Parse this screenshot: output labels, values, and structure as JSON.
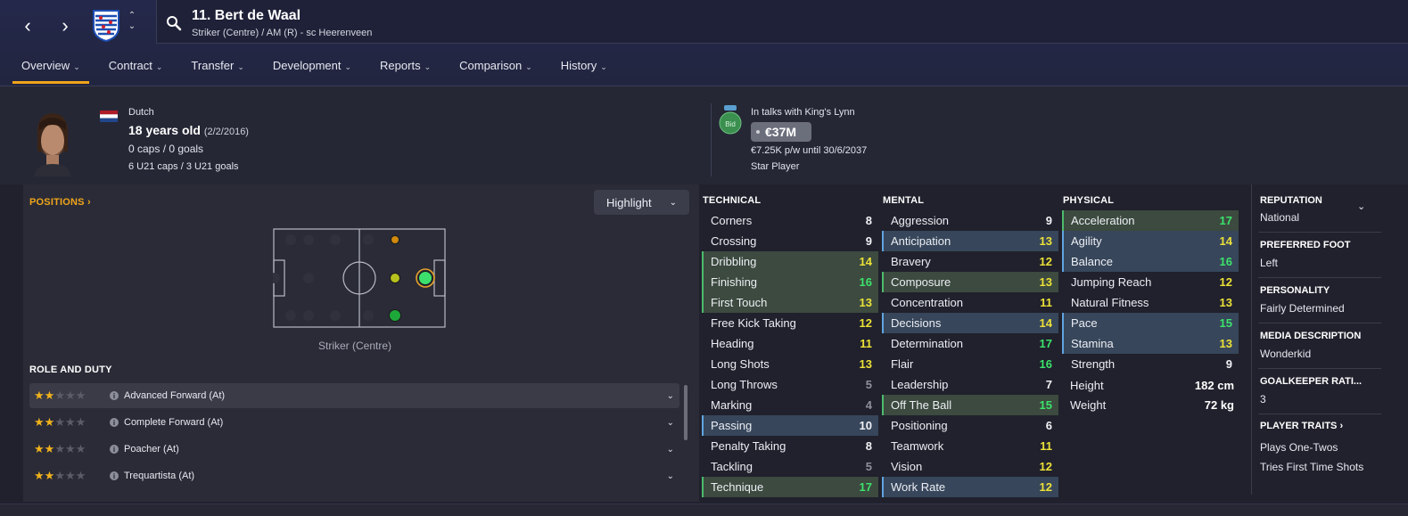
{
  "header": {
    "player_name": "11. Bert de Waal",
    "player_sub": "Striker (Centre) / AM (R) - sc Heerenveen",
    "tabs": [
      {
        "label": "Overview"
      },
      {
        "label": "Contract"
      },
      {
        "label": "Transfer"
      },
      {
        "label": "Development"
      },
      {
        "label": "Reports"
      },
      {
        "label": "Comparison"
      },
      {
        "label": "History"
      }
    ]
  },
  "info": {
    "nationality": "Dutch",
    "age": "18 years old",
    "dob": "(2/2/2016)",
    "caps": "0 caps / 0 goals",
    "u21_caps": "6 U21 caps / 3 U21 goals",
    "bid_label": "Bid",
    "talks": "In talks with King's Lynn",
    "value": "€37M",
    "wage": "€7.25K p/w until 30/6/2037",
    "status": "Star Player"
  },
  "positions": {
    "title": "POSITIONS",
    "highlight": "Highlight",
    "caption": "Striker (Centre)",
    "role_title": "ROLE AND DUTY",
    "roles": [
      {
        "name": "Advanced Forward (At)",
        "stars": 2
      },
      {
        "name": "Complete Forward (At)",
        "stars": 2
      },
      {
        "name": "Poacher (At)",
        "stars": 2
      },
      {
        "name": "Trequartista (At)",
        "stars": 2
      }
    ]
  },
  "attributes": {
    "technical_title": "TECHNICAL",
    "mental_title": "MENTAL",
    "physical_title": "PHYSICAL",
    "technical": [
      {
        "name": "Corners",
        "value": "8",
        "hl": ""
      },
      {
        "name": "Crossing",
        "value": "9",
        "hl": ""
      },
      {
        "name": "Dribbling",
        "value": "14",
        "hl": "green"
      },
      {
        "name": "Finishing",
        "value": "16",
        "hl": "green"
      },
      {
        "name": "First Touch",
        "value": "13",
        "hl": "green"
      },
      {
        "name": "Free Kick Taking",
        "value": "12",
        "hl": ""
      },
      {
        "name": "Heading",
        "value": "11",
        "hl": ""
      },
      {
        "name": "Long Shots",
        "value": "13",
        "hl": ""
      },
      {
        "name": "Long Throws",
        "value": "5",
        "hl": ""
      },
      {
        "name": "Marking",
        "value": "4",
        "hl": ""
      },
      {
        "name": "Passing",
        "value": "10",
        "hl": "blue"
      },
      {
        "name": "Penalty Taking",
        "value": "8",
        "hl": ""
      },
      {
        "name": "Tackling",
        "value": "5",
        "hl": ""
      },
      {
        "name": "Technique",
        "value": "17",
        "hl": "green"
      }
    ],
    "mental": [
      {
        "name": "Aggression",
        "value": "9",
        "hl": ""
      },
      {
        "name": "Anticipation",
        "value": "13",
        "hl": "blue"
      },
      {
        "name": "Bravery",
        "value": "12",
        "hl": ""
      },
      {
        "name": "Composure",
        "value": "13",
        "hl": "green"
      },
      {
        "name": "Concentration",
        "value": "11",
        "hl": ""
      },
      {
        "name": "Decisions",
        "value": "14",
        "hl": "blue"
      },
      {
        "name": "Determination",
        "value": "17",
        "hl": ""
      },
      {
        "name": "Flair",
        "value": "16",
        "hl": ""
      },
      {
        "name": "Leadership",
        "value": "7",
        "hl": ""
      },
      {
        "name": "Off The Ball",
        "value": "15",
        "hl": "green"
      },
      {
        "name": "Positioning",
        "value": "6",
        "hl": ""
      },
      {
        "name": "Teamwork",
        "value": "11",
        "hl": ""
      },
      {
        "name": "Vision",
        "value": "12",
        "hl": ""
      },
      {
        "name": "Work Rate",
        "value": "12",
        "hl": "blue"
      }
    ],
    "physical": [
      {
        "name": "Acceleration",
        "value": "17",
        "hl": "green"
      },
      {
        "name": "Agility",
        "value": "14",
        "hl": "blue"
      },
      {
        "name": "Balance",
        "value": "16",
        "hl": "blue"
      },
      {
        "name": "Jumping Reach",
        "value": "12",
        "hl": ""
      },
      {
        "name": "Natural Fitness",
        "value": "13",
        "hl": ""
      },
      {
        "name": "Pace",
        "value": "15",
        "hl": "blue"
      },
      {
        "name": "Stamina",
        "value": "13",
        "hl": "blue"
      },
      {
        "name": "Strength",
        "value": "9",
        "hl": ""
      }
    ],
    "height_label": "Height",
    "height": "182 cm",
    "weight_label": "Weight",
    "weight": "72 kg"
  },
  "profile": {
    "reputation_label": "REPUTATION",
    "reputation": "National",
    "foot_label": "PREFERRED FOOT",
    "foot": "Left",
    "personality_label": "PERSONALITY",
    "personality": "Fairly Determined",
    "media_label": "MEDIA DESCRIPTION",
    "media": "Wonderkid",
    "gk_label": "GOALKEEPER RATI...",
    "gk": "3",
    "traits_label": "PLAYER TRAITS",
    "traits": [
      "Plays One-Twos",
      "Tries First Time Shots"
    ]
  },
  "colors": {
    "accent": "#f0a51a",
    "value_white": "#f1f2f6",
    "value_grey": "#8e909c",
    "value_yellow": "#ece138",
    "value_green": "#3ce36b",
    "highlight_green": "#3c4a3f",
    "highlight_blue": "#37465a"
  }
}
